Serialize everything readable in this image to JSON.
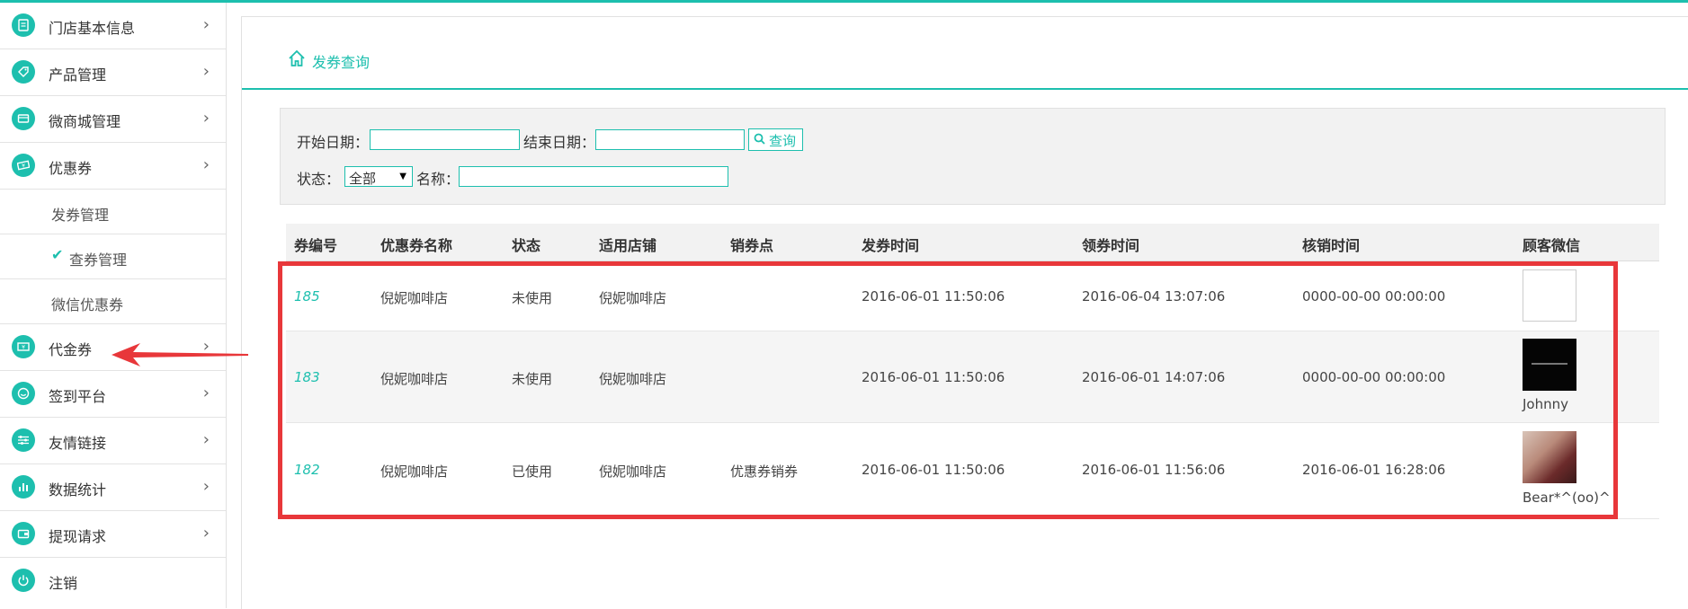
{
  "sidebar": {
    "items": [
      {
        "label": "门店基本信息",
        "icon": "store-info-icon"
      },
      {
        "label": "产品管理",
        "icon": "tag-icon"
      },
      {
        "label": "微商城管理",
        "icon": "shop-icon"
      },
      {
        "label": "优惠券",
        "icon": "coupon-icon"
      },
      {
        "label": "代金券",
        "icon": "voucher-icon"
      },
      {
        "label": "签到平台",
        "icon": "smile-icon"
      },
      {
        "label": "友情链接",
        "icon": "sliders-icon"
      },
      {
        "label": "数据统计",
        "icon": "bar-chart-icon"
      },
      {
        "label": "提现请求",
        "icon": "wallet-icon"
      },
      {
        "label": "注销",
        "icon": "power-icon"
      }
    ],
    "coupon_sub": [
      {
        "label": "发券管理",
        "active": false
      },
      {
        "label": "查券管理",
        "active": true
      },
      {
        "label": "微信优惠券",
        "active": false
      }
    ]
  },
  "breadcrumb": {
    "label": "发券查询"
  },
  "filter": {
    "start_date_label": "开始日期：",
    "end_date_label": "结束日期：",
    "search_button": "查询",
    "status_label": "状态：",
    "status_value": "全部",
    "name_label": "名称："
  },
  "table": {
    "headers": [
      "券编号",
      "优惠券名称",
      "状态",
      "适用店铺",
      "销券点",
      "发券时间",
      "领券时间",
      "核销时间",
      "顾客微信"
    ],
    "rows": [
      {
        "id": "185",
        "name": "倪妮咖啡店",
        "status": "未使用",
        "shop": "倪妮咖啡店",
        "point": "",
        "issued": "2016-06-01 11:50:06",
        "received": "2016-06-04 13:07:06",
        "verified": "0000-00-00 00:00:00",
        "wechat": ""
      },
      {
        "id": "183",
        "name": "倪妮咖啡店",
        "status": "未使用",
        "shop": "倪妮咖啡店",
        "point": "",
        "issued": "2016-06-01 11:50:06",
        "received": "2016-06-01 14:07:06",
        "verified": "0000-00-00 00:00:00",
        "wechat": "Johnny"
      },
      {
        "id": "182",
        "name": "倪妮咖啡店",
        "status": "已使用",
        "shop": "倪妮咖啡店",
        "point": "优惠券销券",
        "issued": "2016-06-01 11:50:06",
        "received": "2016-06-01 11:56:06",
        "verified": "2016-06-01 16:28:06",
        "wechat": "Bear*^(oo)^"
      }
    ]
  },
  "colors": {
    "accent": "#1dbfae",
    "annotation": "#e8373a"
  }
}
